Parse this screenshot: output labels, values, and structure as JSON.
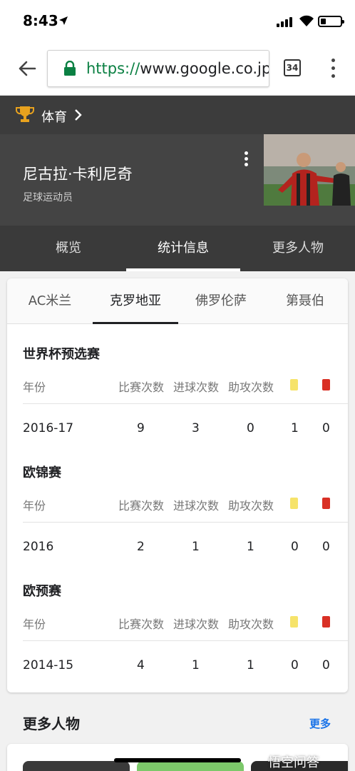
{
  "status_bar": {
    "time": "8:43"
  },
  "browser": {
    "url_scheme": "https://",
    "url_host": "www.google.co.jp/",
    "tab_count": "34"
  },
  "sports_bar": {
    "label": "体育"
  },
  "player": {
    "name": "尼古拉·卡利尼奇",
    "subtitle": "足球运动员"
  },
  "nav_tabs": [
    {
      "label": "概览"
    },
    {
      "label": "统计信息",
      "active": true
    },
    {
      "label": "更多人物"
    }
  ],
  "team_tabs": [
    {
      "label": "AC米兰"
    },
    {
      "label": "克罗地亚",
      "active": true
    },
    {
      "label": "佛罗伦萨"
    },
    {
      "label": "第聂伯"
    }
  ],
  "stats": {
    "columns": {
      "year": "年份",
      "matches": "比赛次数",
      "goals": "进球次数",
      "assists": "助攻次数"
    },
    "sections": [
      {
        "title": "世界杯预选赛",
        "row": {
          "year": "2016-17",
          "matches": "9",
          "goals": "3",
          "assists": "0",
          "yellow": "1",
          "red": "0"
        }
      },
      {
        "title": "欧锦赛",
        "row": {
          "year": "2016",
          "matches": "2",
          "goals": "1",
          "assists": "1",
          "yellow": "0",
          "red": "0"
        }
      },
      {
        "title": "欧预赛",
        "row": {
          "year": "2014-15",
          "matches": "4",
          "goals": "1",
          "assists": "1",
          "yellow": "0",
          "red": "0"
        }
      }
    ]
  },
  "more_people": {
    "title": "更多人物",
    "link": "更多"
  },
  "watermark": "悟空问答",
  "colors": {
    "accent_green": "#0b8043",
    "link_blue": "#1a73e8",
    "yellow_card": "#f6e36a",
    "red_card": "#d93025",
    "dark_header": "#444444"
  }
}
